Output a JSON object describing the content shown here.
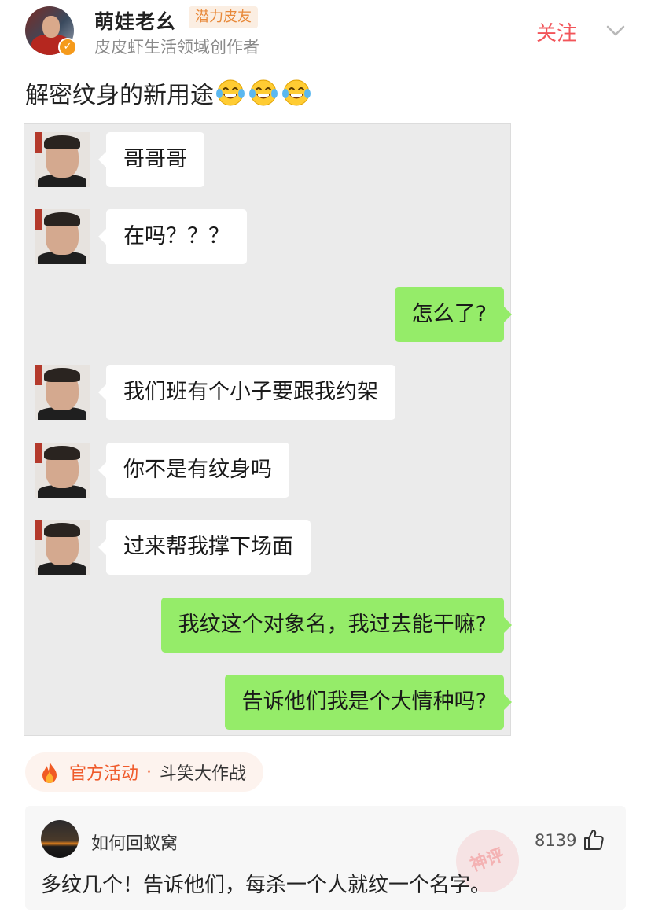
{
  "header": {
    "username": "萌娃老幺",
    "badge": "潜力皮友",
    "subtitle": "皮皮虾生活领域创作者",
    "follow_label": "关注"
  },
  "post": {
    "text": "解密纹身的新用途",
    "emoji_icon": "laughing-tears-emoji",
    "emoji_count": 3
  },
  "chat": {
    "messages": [
      {
        "side": "left",
        "text": "哥哥哥"
      },
      {
        "side": "left",
        "text": "在吗？？？"
      },
      {
        "side": "right",
        "text": "怎么了?"
      },
      {
        "side": "left",
        "text": "我们班有个小子要跟我约架"
      },
      {
        "side": "left",
        "text": "你不是有纹身吗"
      },
      {
        "side": "left",
        "text": "过来帮我撑下场面"
      },
      {
        "side": "right",
        "text": "我纹这个对象名，我过去能干嘛?"
      },
      {
        "side": "right",
        "text": "告诉他们我是个大情种吗?"
      }
    ]
  },
  "activity": {
    "official_label": "官方活动",
    "separator": "·",
    "name": "斗笑大作战"
  },
  "comment": {
    "author": "如何回蚁窝",
    "likes": "8139",
    "text": "多纹几个！告诉他们，每杀一个人就纹一个名字。",
    "watermark": "神评"
  },
  "colors": {
    "accent": "#f2555a",
    "bubble_green": "#95ec69",
    "badge_orange": "#e8893a"
  }
}
